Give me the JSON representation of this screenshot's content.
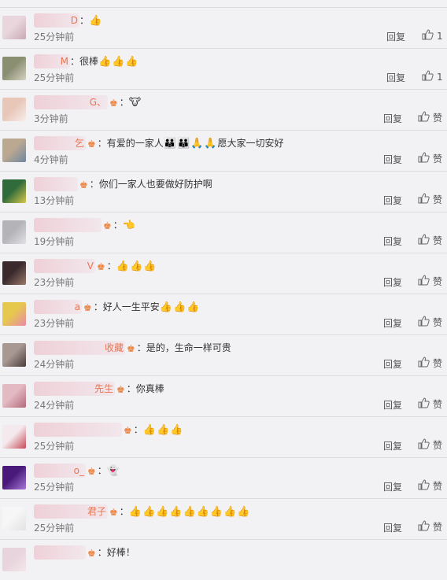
{
  "comments": [
    {
      "name": "D",
      "fan": false,
      "text": "：",
      "emoji": "👍",
      "time": "25分钟前",
      "reply": "回复",
      "like": "1",
      "avatar": [
        "#e9d6dc",
        "#c9aab4"
      ]
    },
    {
      "name": "M",
      "fan": false,
      "text": "：很棒",
      "emoji": "👍👍👍",
      "time": "25分钟前",
      "reply": "回复",
      "like": "1",
      "avatar": [
        "#8a8f72",
        "#d7d2c2"
      ]
    },
    {
      "name": "G、",
      "fan": true,
      "text": "：",
      "emoji": "🐮",
      "time": "3分钟前",
      "reply": "回复",
      "like": "赞",
      "avatar": [
        "#e8c6b8",
        "#f7eeea"
      ]
    },
    {
      "name": "乞",
      "fan": true,
      "text": "：有爱的一家人",
      "emoji": "👪👪🙏🙏",
      "text2": "愿大家一切安好",
      "time": "4分钟前",
      "reply": "回复",
      "like": "赞",
      "avatar": [
        "#bba891",
        "#6f86a2"
      ]
    },
    {
      "name": "",
      "fan": true,
      "text": "：你们一家人也要做好防护啊",
      "emoji": "",
      "time": "13分钟前",
      "reply": "回复",
      "like": "赞",
      "avatar": [
        "#2f6b3b",
        "#d9c84a"
      ]
    },
    {
      "name": "",
      "fan": true,
      "text": "：",
      "emoji": "👈",
      "time": "19分钟前",
      "reply": "回复",
      "like": "赞",
      "avatar": [
        "#b4b4b8",
        "#e2e2e6"
      ]
    },
    {
      "name": "V",
      "fan": true,
      "text": "：",
      "emoji": "👍👍👍",
      "time": "23分钟前",
      "reply": "回复",
      "like": "赞",
      "avatar": [
        "#3a2a2e",
        "#9a7a6a"
      ]
    },
    {
      "name": "a",
      "fan": true,
      "text": "：好人一生平安",
      "emoji": "👍👍👍",
      "time": "23分钟前",
      "reply": "回复",
      "like": "赞",
      "avatar": [
        "#e6c84e",
        "#e98aa8"
      ]
    },
    {
      "name": "收藏",
      "fan": true,
      "text": "：是的，生命一样可贵",
      "emoji": "",
      "time": "24分钟前",
      "reply": "回复",
      "like": "赞",
      "avatar": [
        "#a89892",
        "#4a3c3a"
      ]
    },
    {
      "name": "先生",
      "fan": true,
      "text": "：你真棒",
      "emoji": "",
      "time": "24分钟前",
      "reply": "回复",
      "like": "赞",
      "avatar": [
        "#e3b9c2",
        "#b36b7a"
      ]
    },
    {
      "name": "",
      "fan": true,
      "text": "：",
      "emoji": "👍👍👍",
      "time": "25分钟前",
      "reply": "回复",
      "like": "赞",
      "avatar": [
        "#f4eaee",
        "#c84a58"
      ]
    },
    {
      "name": "o_",
      "fan": true,
      "text": "：",
      "emoji": "👻",
      "time": "25分钟前",
      "reply": "回复",
      "like": "赞",
      "avatar": [
        "#4a1a7a",
        "#a878d8"
      ]
    },
    {
      "name": "君子",
      "fan": true,
      "text": "：",
      "emoji": "👍👍👍👍👍👍👍👍👍",
      "time": "25分钟前",
      "reply": "回复",
      "like": "赞",
      "avatar": [
        "#f6f6f6",
        "#e2e2e2"
      ]
    },
    {
      "name": "",
      "fan": true,
      "text": "：好棒！",
      "emoji": "",
      "time": "",
      "reply": "",
      "like": "",
      "avatar": [
        "#e8d4dc",
        "#f3e6ea"
      ]
    }
  ],
  "icons": {
    "fan_badge": "fan-crown-icon",
    "like": "thumb-up-icon"
  },
  "colors": {
    "name": "#eb7350",
    "background": "#f2f2f5",
    "divider": "#dcdcdc"
  }
}
